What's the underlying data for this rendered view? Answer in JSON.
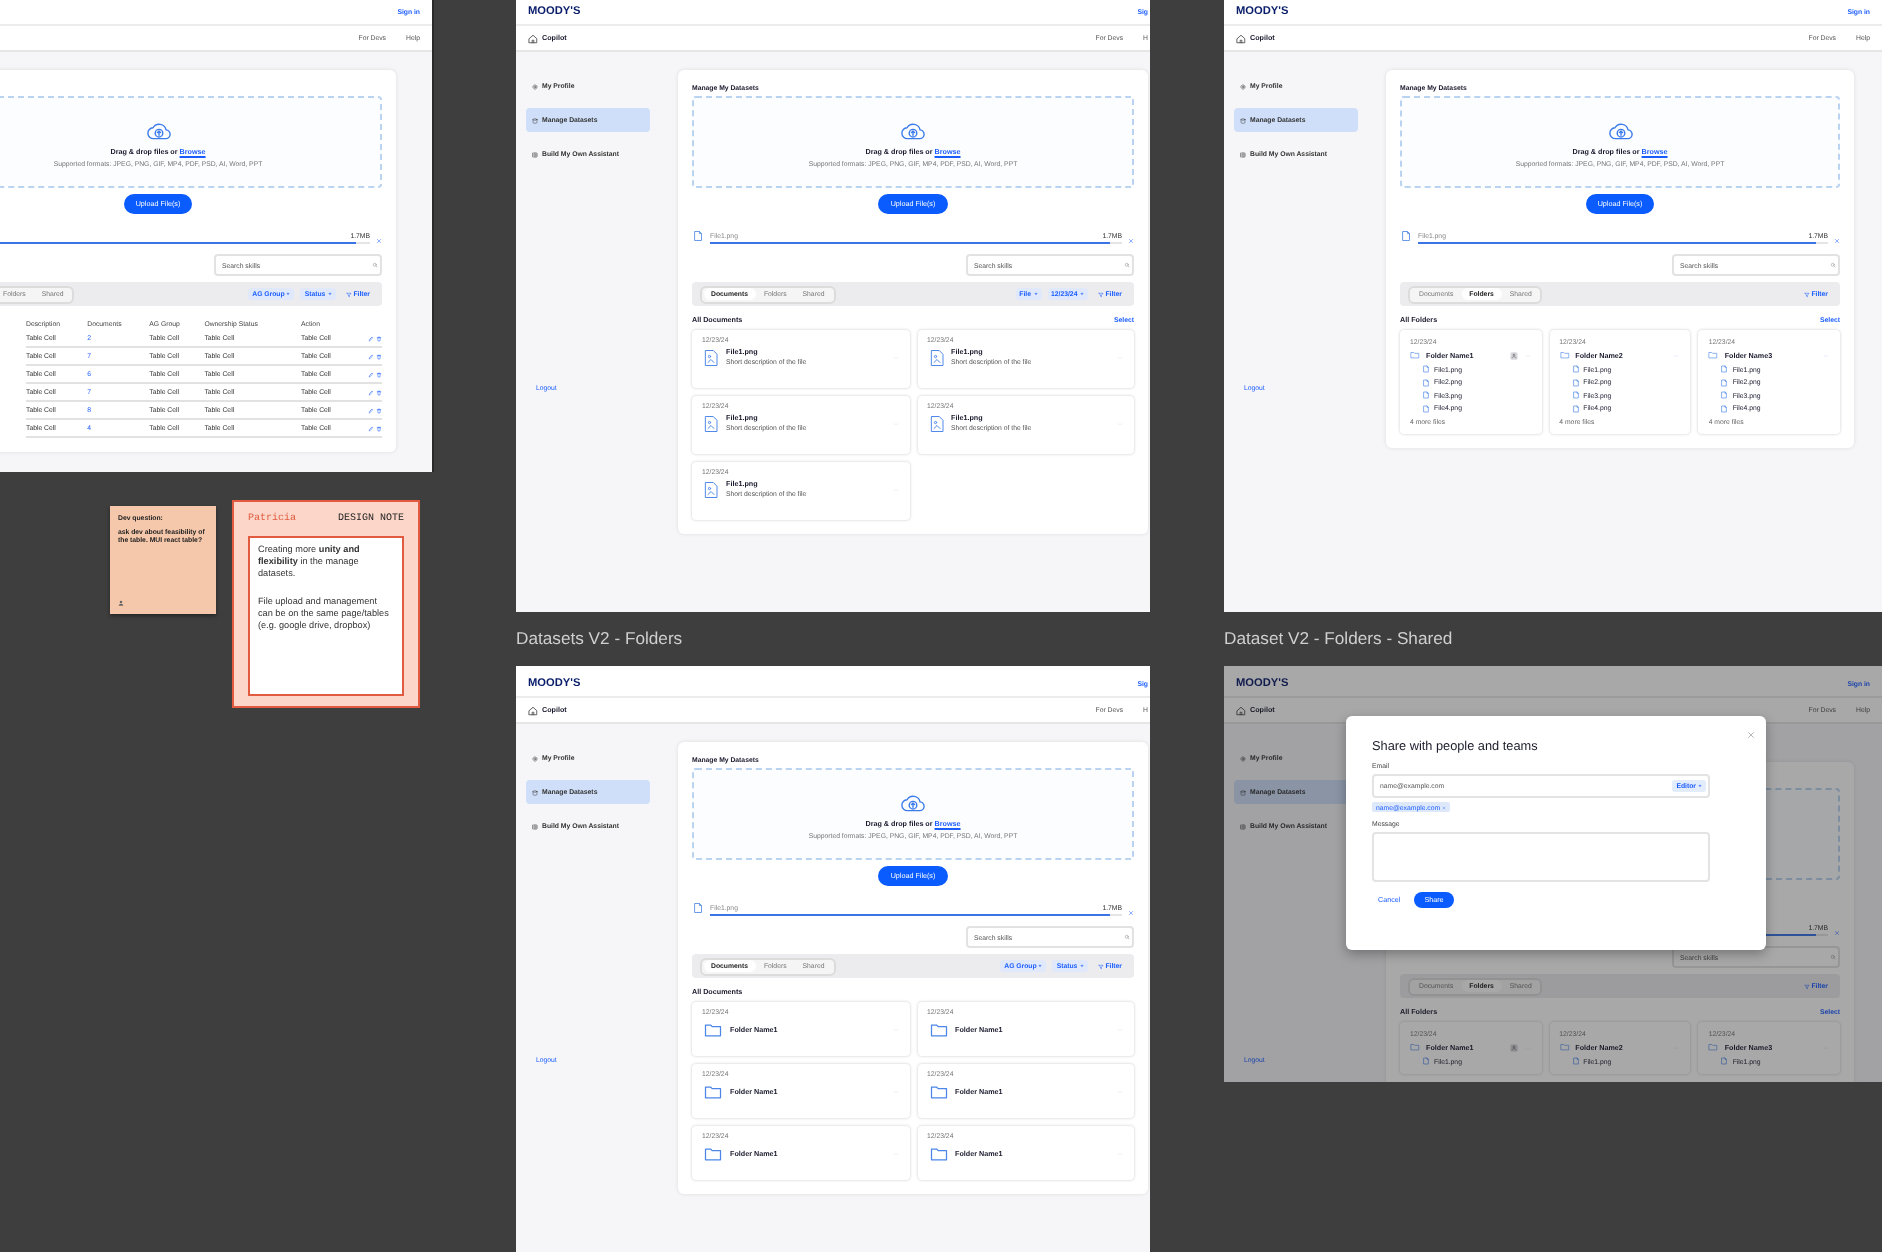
{
  "frames": [
    {
      "header": {
        "sign_in": "Sign in"
      },
      "subheader": {
        "links": [
          "For Devs",
          "Help"
        ]
      },
      "card": {
        "dropzone": {
          "prompt": "Drag & drop files or",
          "link": "Browse",
          "formats": "Supported formats: JPEG, PNG, GIF, MP4, PDF, PSD, AI, Word, PPT"
        },
        "upload_button": "Upload File(s)",
        "progress": {
          "size": "1.7MB",
          "level": 0.97
        },
        "search": {
          "placeholder": "Search skills"
        },
        "tabs": [
          {
            "label": "Folders",
            "selected": false
          },
          {
            "label": "Shared",
            "selected": false
          }
        ],
        "chips": [
          {
            "kind": "dropdown",
            "label": "AG Group"
          },
          {
            "kind": "dropdown",
            "label": "Status"
          },
          {
            "kind": "filter",
            "label": "Filter"
          }
        ],
        "table": {
          "columns": [
            "Description",
            "Documents",
            "AG Group",
            "Ownership Status",
            "Action"
          ],
          "rows": [
            [
              "Table Cell",
              "2",
              "Table Cell",
              "Table Cell",
              "Table Cell"
            ],
            [
              "Table Cell",
              "7",
              "Table Cell",
              "Table Cell",
              "Table Cell"
            ],
            [
              "Table Cell",
              "6",
              "Table Cell",
              "Table Cell",
              "Table Cell"
            ],
            [
              "Table Cell",
              "7",
              "Table Cell",
              "Table Cell",
              "Table Cell"
            ],
            [
              "Table Cell",
              "8",
              "Table Cell",
              "Table Cell",
              "Table Cell"
            ],
            [
              "Table Cell",
              "4",
              "Table Cell",
              "Table Cell",
              "Table Cell"
            ]
          ]
        }
      }
    },
    {
      "header": {
        "logo": "MOODY'S",
        "sign_in": "Sig"
      },
      "subheader": {
        "app": "Copilot",
        "links": [
          "For Devs",
          "H"
        ]
      },
      "nav": {
        "items": [
          {
            "label": "My Profile",
            "selected": false
          },
          {
            "label": "Manage Datasets",
            "selected": true
          },
          {
            "label": "Build My Own Assistant",
            "selected": false
          }
        ],
        "logout": "Logout"
      },
      "card": {
        "title": "Manage My Datasets",
        "dropzone": {
          "prompt": "Drag & drop files or",
          "link": "Browse",
          "formats": "Supported formats: JPEG, PNG, GIF, MP4, PDF, PSD, AI, Word, PPT"
        },
        "upload_button": "Upload File(s)",
        "progress": {
          "file": "File1.png",
          "size": "1.7MB",
          "level": 0.97
        },
        "search": {
          "placeholder": "Search skills"
        },
        "tabs": [
          {
            "label": "Documents",
            "selected": true
          },
          {
            "label": "Folders",
            "selected": false
          },
          {
            "label": "Shared",
            "selected": false
          }
        ],
        "chips": [
          {
            "kind": "dropdown",
            "label": "File"
          },
          {
            "kind": "dropdown",
            "label": "12/23/24"
          },
          {
            "kind": "filter",
            "label": "Filter"
          }
        ],
        "section": {
          "title": "All Documents",
          "action": "Select"
        },
        "items": [
          {
            "kind": "file",
            "date": "12/23/24",
            "name": "File1.png",
            "description": "Short description of the file"
          },
          {
            "kind": "file",
            "date": "12/23/24",
            "name": "File1.png",
            "description": "Short description of the file"
          },
          {
            "kind": "file",
            "date": "12/23/24",
            "name": "File1.png",
            "description": "Short description of the file"
          },
          {
            "kind": "file",
            "date": "12/23/24",
            "name": "File1.png",
            "description": "Short description of the file"
          },
          {
            "kind": "file",
            "date": "12/23/24",
            "name": "File1.png",
            "description": "Short description of the file"
          }
        ]
      }
    },
    {
      "header": {
        "logo": "MOODY'S",
        "sign_in": "Sign in"
      },
      "subheader": {
        "app": "Copilot",
        "links": [
          "For Devs",
          "Help"
        ]
      },
      "nav": {
        "items": [
          {
            "label": "My Profile",
            "selected": false
          },
          {
            "label": "Manage Datasets",
            "selected": true
          },
          {
            "label": "Build My Own Assistant",
            "selected": false
          }
        ],
        "logout": "Logout"
      },
      "card": {
        "title": "Manage My Datasets",
        "dropzone": {
          "prompt": "Drag & drop files or",
          "link": "Browse",
          "formats": "Supported formats: JPEG, PNG, GIF, MP4, PDF, PSD, AI, Word, PPT"
        },
        "upload_button": "Upload File(s)",
        "progress": {
          "file": "File1.png",
          "size": "1.7MB",
          "level": 0.97
        },
        "search": {
          "placeholder": "Search skills"
        },
        "tabs": [
          {
            "label": "Documents",
            "selected": false
          },
          {
            "label": "Folders",
            "selected": true
          },
          {
            "label": "Shared",
            "selected": false
          }
        ],
        "chips": [
          {
            "kind": "filter",
            "label": "Filter"
          }
        ],
        "section": {
          "title": "All Folders",
          "action": "Select"
        },
        "items": [
          {
            "kind": "folder_tree",
            "date": "12/23/24",
            "name": "Folder Name1",
            "shared": true,
            "files": [
              "File1.png",
              "File2.png",
              "File3.png",
              "File4.png"
            ],
            "more": "4 more files"
          },
          {
            "kind": "folder_tree",
            "date": "12/23/24",
            "name": "Folder Name2",
            "shared": false,
            "files": [
              "File1.png",
              "File2.png",
              "File3.png",
              "File4.png"
            ],
            "more": "4 more files"
          },
          {
            "kind": "folder_tree",
            "date": "12/23/24",
            "name": "Folder Name3",
            "shared": false,
            "files": [
              "File1.png",
              "File2.png",
              "File3.png",
              "File4.png"
            ],
            "more": "4 more files"
          }
        ]
      }
    },
    {
      "title": "Datasets V2 - Folders",
      "header": {
        "logo": "MOODY'S",
        "sign_in": "Sig"
      },
      "subheader": {
        "app": "Copilot",
        "links": [
          "For Devs",
          "H"
        ]
      },
      "nav": {
        "items": [
          {
            "label": "My Profile",
            "selected": false
          },
          {
            "label": "Manage Datasets",
            "selected": true
          },
          {
            "label": "Build My Own Assistant",
            "selected": false
          }
        ],
        "logout": "Logout"
      },
      "card": {
        "title": "Manage My Datasets",
        "dropzone": {
          "prompt": "Drag & drop files or",
          "link": "Browse",
          "formats": "Supported formats: JPEG, PNG, GIF, MP4, PDF, PSD, AI, Word, PPT"
        },
        "upload_button": "Upload File(s)",
        "progress": {
          "file": "File1.png",
          "size": "1.7MB",
          "level": 0.97
        },
        "search": {
          "placeholder": "Search skills"
        },
        "tabs": [
          {
            "label": "Documents",
            "selected": true
          },
          {
            "label": "Folders",
            "selected": false
          },
          {
            "label": "Shared",
            "selected": false
          }
        ],
        "chips": [
          {
            "kind": "dropdown",
            "label": "AG Group"
          },
          {
            "kind": "dropdown",
            "label": "Status"
          },
          {
            "kind": "filter",
            "label": "Filter"
          }
        ],
        "section": {
          "title": "All Documents"
        },
        "items": [
          {
            "kind": "folder",
            "date": "12/23/24",
            "name": "Folder Name1"
          },
          {
            "kind": "folder",
            "date": "12/23/24",
            "name": "Folder Name1"
          },
          {
            "kind": "folder",
            "date": "12/23/24",
            "name": "Folder Name1"
          },
          {
            "kind": "folder",
            "date": "12/23/24",
            "name": "Folder Name1"
          },
          {
            "kind": "folder",
            "date": "12/23/24",
            "name": "Folder Name1"
          },
          {
            "kind": "folder",
            "date": "12/23/24",
            "name": "Folder Name1"
          }
        ]
      }
    },
    {
      "title": "Dataset V2 - Folders - Shared",
      "header": {
        "logo": "MOODY'S",
        "sign_in": "Sign in"
      },
      "subheader": {
        "app": "Copilot",
        "links": [
          "For Devs",
          "Help"
        ]
      },
      "nav": {
        "items": [
          {
            "label": "My Profile",
            "selected": false
          },
          {
            "label": "Manage Datasets",
            "selected": true
          },
          {
            "label": "Build My Own Assistant",
            "selected": false
          }
        ],
        "logout": "Logout"
      },
      "card": {
        "progress": {
          "size": "1.7MB",
          "level": 0.97
        },
        "search": {
          "placeholder": "Search skills"
        },
        "tabs": [
          {
            "label": "Documents",
            "selected": false
          },
          {
            "label": "Folders",
            "selected": true
          },
          {
            "label": "Shared",
            "selected": false
          }
        ],
        "chips": [
          {
            "kind": "filter",
            "label": "Filter"
          }
        ],
        "section": {
          "title": "All Folders",
          "action": "Select"
        },
        "items": [
          {
            "kind": "folder_tree",
            "date": "12/23/24",
            "name": "Folder Name1",
            "shared": true,
            "files": [
              "File1.png"
            ]
          },
          {
            "kind": "folder_tree",
            "date": "12/23/24",
            "name": "Folder Name2",
            "shared": false,
            "files": [
              "File1.png"
            ]
          },
          {
            "kind": "folder_tree",
            "date": "12/23/24",
            "name": "Folder Name3",
            "shared": false,
            "files": [
              "File1.png"
            ]
          }
        ]
      },
      "dialog": {
        "title": "Share with people and teams",
        "email_label": "Email",
        "email": "name@example.com",
        "role": "Editor",
        "recipients": [
          "name@example.com"
        ],
        "message_label": "Message",
        "cancel": "Cancel",
        "confirm": "Share"
      }
    }
  ],
  "notes": [
    {
      "kind": "sticky",
      "heading": "Dev question:",
      "text": "ask dev about feasibility of the table. MUI react table?"
    },
    {
      "kind": "design_note",
      "author": "Patricia",
      "tag": "DESIGN NOTE",
      "paragraphs": [
        "Creating more **unity and flexibility** in the manage datasets.",
        "File upload and management can be on the same page/tables (e.g. google drive, dropbox)"
      ]
    }
  ]
}
